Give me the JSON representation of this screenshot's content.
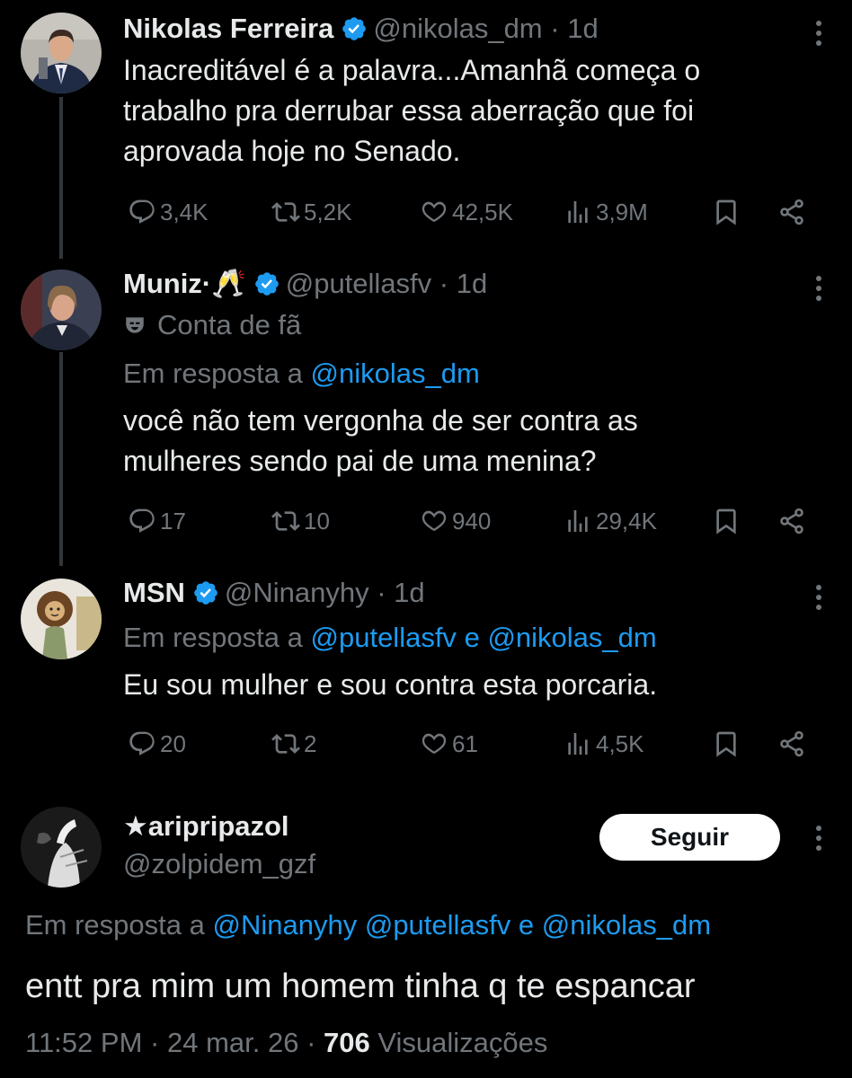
{
  "tweets": [
    {
      "name": "Nikolas Ferreira",
      "handle": "@nikolas_dm",
      "time": "· 1d",
      "lines": [
        "Inacreditável é a palavra...Amanhã começa o",
        "trabalho pra derrubar essa aberração que foi",
        "aprovada hoje no Senado."
      ],
      "replies": "3,4K",
      "retweets": "5,2K",
      "likes": "42,5K",
      "views": "3,9M"
    },
    {
      "name": "Muniz·🥂",
      "handle": "@putellasfv",
      "time": "· 1d",
      "fan_label": "Conta de fã",
      "reply_prefix": "Em resposta a",
      "reply_mentions": [
        "@nikolas_dm"
      ],
      "lines": [
        "você não tem vergonha de ser contra as",
        "mulheres sendo pai de uma menina?"
      ],
      "replies": "17",
      "retweets": "10",
      "likes": "940",
      "views": "29,4K"
    },
    {
      "name": "MSN",
      "handle": "@Ninanyhy",
      "time": "· 1d",
      "reply_prefix": "Em resposta a",
      "reply_mentions": [
        "@putellasfv",
        "@nikolas_dm"
      ],
      "reply_joiner": "e",
      "lines": [
        "Eu sou mulher e sou contra esta porcaria."
      ],
      "replies": "20",
      "retweets": "2",
      "likes": "61",
      "views": "4,5K"
    }
  ],
  "main": {
    "name": "★aripripazol",
    "handle": "@zolpidem_gzf",
    "follow_label": "Seguir",
    "reply_prefix": "Em resposta a",
    "reply_mentions": [
      "@Ninanyhy",
      "@putellasfv",
      "@nikolas_dm"
    ],
    "reply_joiner": "e",
    "text": "entt pra mim um homem tinha q te espancar",
    "time": "11:52 PM",
    "date": "24 mar. 26",
    "views_count": "706",
    "views_label": "Visualizações",
    "separator": "·"
  },
  "colors": {
    "background": "#000000",
    "text": "#e7e9ea",
    "muted": "#71767b",
    "link": "#1d9bf0",
    "verified": "#1d9bf0"
  },
  "icons": [
    "reply-icon",
    "retweet-icon",
    "like-icon",
    "views-icon",
    "bookmark-icon",
    "share-icon",
    "verified-badge-icon",
    "more-icon",
    "theater-mask-icon"
  ]
}
